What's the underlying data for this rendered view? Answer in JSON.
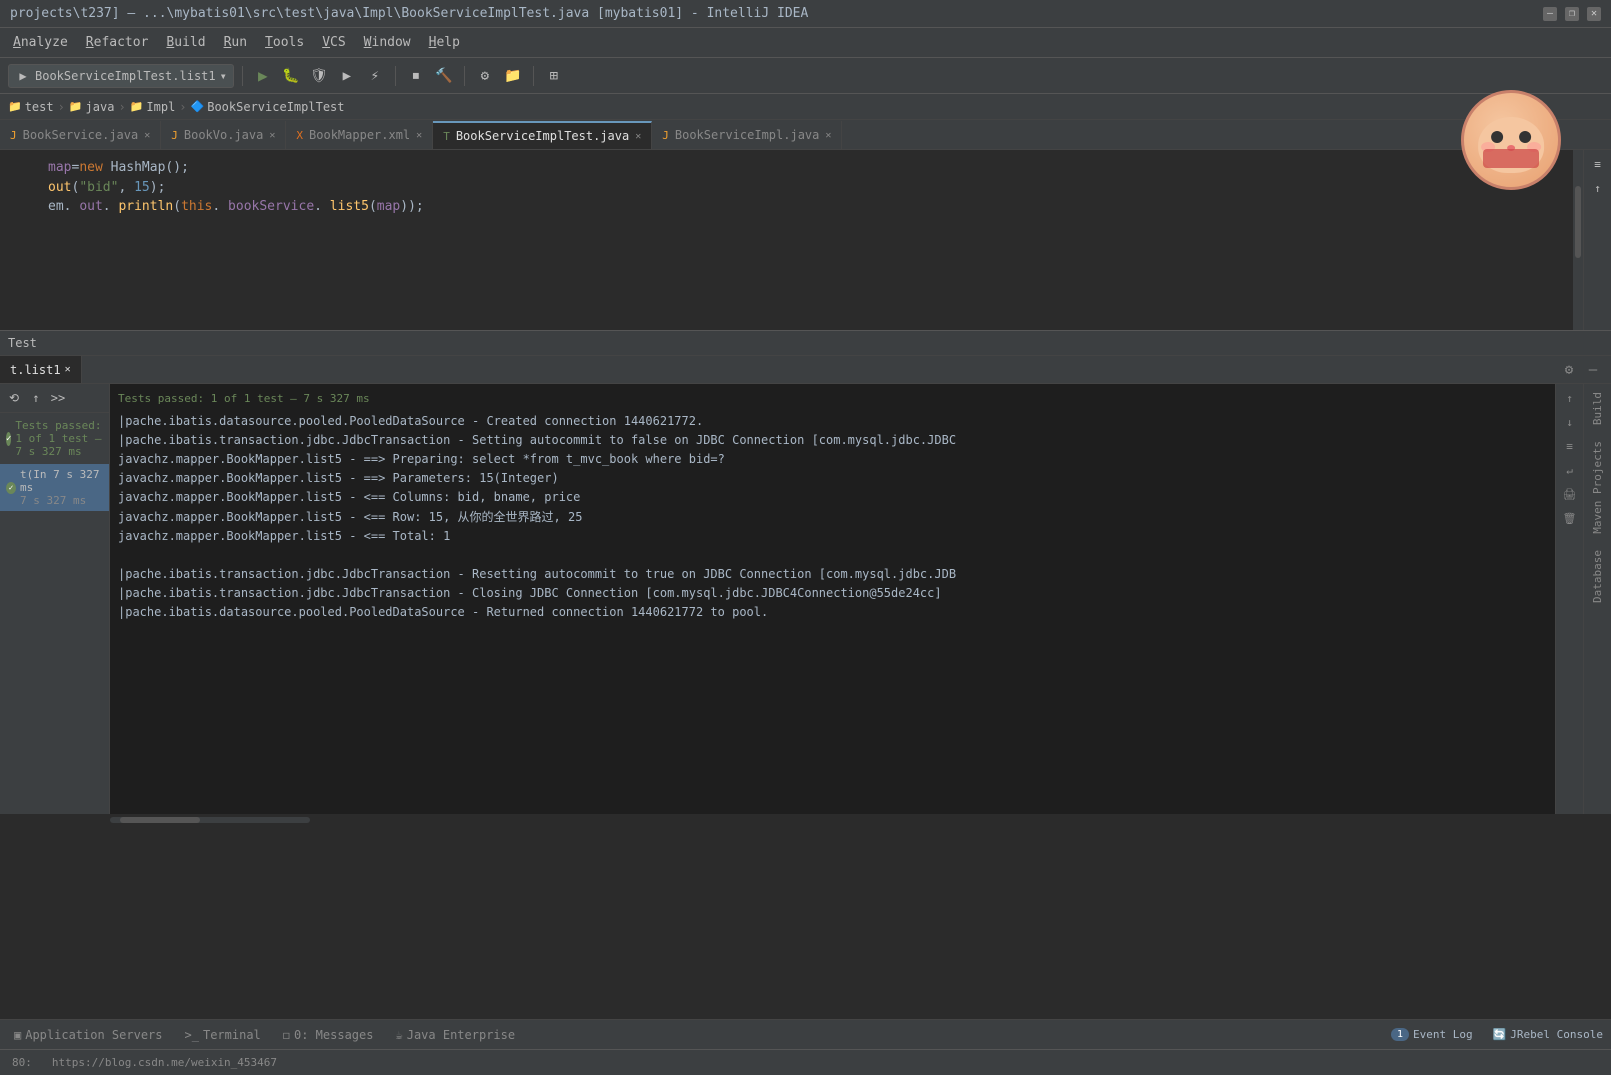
{
  "titleBar": {
    "text": "projects\\t237] – ...\\mybatis01\\src\\test\\java\\Impl\\BookServiceImplTest.java [mybatis01] - IntelliJ IDEA",
    "minimizeLabel": "–",
    "restoreLabel": "❐",
    "closeLabel": "✕"
  },
  "menuBar": {
    "items": [
      "Analyze",
      "Refactor",
      "Build",
      "Run",
      "Tools",
      "VCS",
      "Window",
      "Help"
    ]
  },
  "toolbar": {
    "runConfig": "BookServiceImplTest.list1",
    "dropdown": "▾"
  },
  "breadcrumb": {
    "items": [
      "test",
      "java",
      "Impl",
      "BookServiceImplTest"
    ]
  },
  "tabs": [
    {
      "label": "BookService.java",
      "type": "java",
      "active": false
    },
    {
      "label": "BookVo.java",
      "type": "java",
      "active": false
    },
    {
      "label": "BookMapper.xml",
      "type": "xml",
      "active": false
    },
    {
      "label": "BookServiceImplTest.java",
      "type": "test",
      "active": true
    },
    {
      "label": "BookServiceImpl.java",
      "type": "java",
      "active": false
    }
  ],
  "codeLines": [
    {
      "num": "",
      "text": "map=new HashMap();"
    },
    {
      "num": "",
      "text": "out(\"bid\", 15);"
    },
    {
      "num": "",
      "text": "em. out. println(this. bookService. list5(map));"
    }
  ],
  "testPanel": {
    "title": "Test",
    "tabLabel": "t.list1",
    "gearIcon": "⚙",
    "minusIcon": "–"
  },
  "testResult": {
    "passText": "Tests passed: 1 of 1 test – 7 s 327 ms",
    "treeItems": [
      {
        "label": "t(In 7 s 327 ms",
        "time": "7 s 327 ms",
        "status": "pass"
      }
    ]
  },
  "consoleLogs": [
    "  |pache.ibatis.datasource.pooled.PooledDataSource - Created connection 1440621772.",
    "  |pache.ibatis.transaction.jdbc.JdbcTransaction - Setting autocommit to false on JDBC Connection [com.mysql.jdbc.JDBC",
    "  javachz.mapper.BookMapper.list5 - ==>  Preparing: select *from t_mvc_book where bid=?",
    "  javachz.mapper.BookMapper.list5 - ==>  Parameters: 15(Integer)",
    "  javachz.mapper.BookMapper.list5 - <==      Columns: bid,  bname,  price",
    "  javachz.mapper.BookMapper.list5 - <==          Row: 15,  从你的全世界路过,  25",
    "  javachz.mapper.BookMapper.list5 - <==        Total: 1",
    "",
    "  |pache.ibatis.transaction.jdbc.JdbcTransaction - Resetting autocommit to true on JDBC Connection [com.mysql.jdbc.JDB",
    "  |pache.ibatis.transaction.jdbc.JdbcTransaction - Closing JDBC Connection [com.mysql.jdbc.JDBC4Connection@55de24cc]",
    "  |pache.ibatis.datasource.pooled.PooledDataSource - Returned connection 1440621772 to pool."
  ],
  "rightSidebarItems": [
    "Build",
    "Maven Projects",
    "Database"
  ],
  "bottomTabs": [
    {
      "label": "Application Servers",
      "icon": "▣",
      "active": false
    },
    {
      "label": "Terminal",
      "icon": ">_",
      "active": false
    },
    {
      "label": "0: Messages",
      "icon": "◻",
      "active": false
    },
    {
      "label": "Java Enterprise",
      "icon": "☕",
      "active": false
    }
  ],
  "statusBar": {
    "lineCol": "80:",
    "url": "https://blog.csdn.me/weixin_453467",
    "eventLog": "Event Log",
    "jrebel": "JRebel Console"
  }
}
